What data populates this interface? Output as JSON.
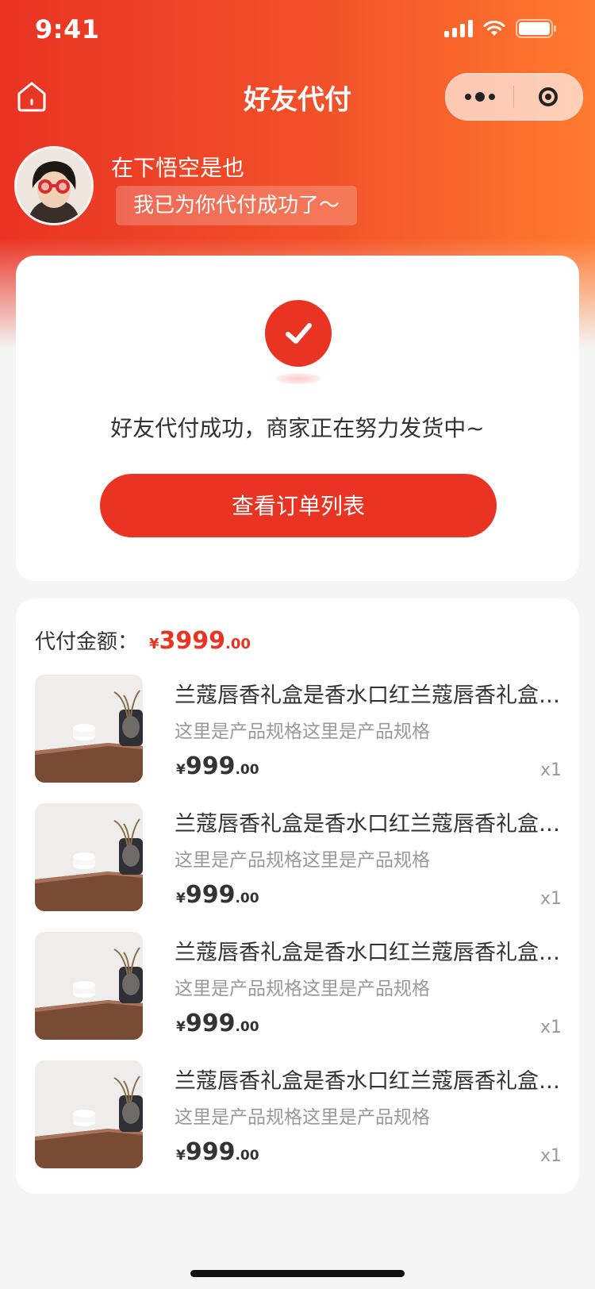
{
  "status_bar": {
    "time": "9:41"
  },
  "nav": {
    "title": "好友代付"
  },
  "friend": {
    "name": "在下悟空是也",
    "message": "我已为你代付成功了～"
  },
  "success": {
    "text": "好友代付成功，商家正在努力发货中~",
    "button_label": "查看订单列表"
  },
  "order": {
    "amount_label": "代付金额：",
    "amount": {
      "currency": "¥",
      "integer": "3999",
      "decimal": ".00"
    },
    "items": [
      {
        "name": "兰蔻唇香礼盒是香水口红兰蔻唇香礼盒是香水口红",
        "spec": "这里是产品规格这里是产品规格",
        "currency": "¥",
        "price_int": "999",
        "price_dec": ".00",
        "qty": "x1"
      },
      {
        "name": "兰蔻唇香礼盒是香水口红兰蔻唇香礼盒是香水口红",
        "spec": "这里是产品规格这里是产品规格",
        "currency": "¥",
        "price_int": "999",
        "price_dec": ".00",
        "qty": "x1"
      },
      {
        "name": "兰蔻唇香礼盒是香水口红兰蔻唇香礼盒是香水口红",
        "spec": "这里是产品规格这里是产品规格",
        "currency": "¥",
        "price_int": "999",
        "price_dec": ".00",
        "qty": "x1"
      },
      {
        "name": "兰蔻唇香礼盒是香水口红兰蔻唇香礼盒是香水口红",
        "spec": "这里是产品规格这里是产品规格",
        "currency": "¥",
        "price_int": "999",
        "price_dec": ".00",
        "qty": "x1"
      }
    ]
  },
  "colors": {
    "primary": "#e93323",
    "gradient_end": "#ff7a2f",
    "background": "#f5f5f5"
  },
  "icons": [
    "home-icon",
    "more-icon",
    "close-mini-program-icon",
    "checkmark-icon",
    "signal-icon",
    "wifi-icon",
    "battery-icon"
  ]
}
